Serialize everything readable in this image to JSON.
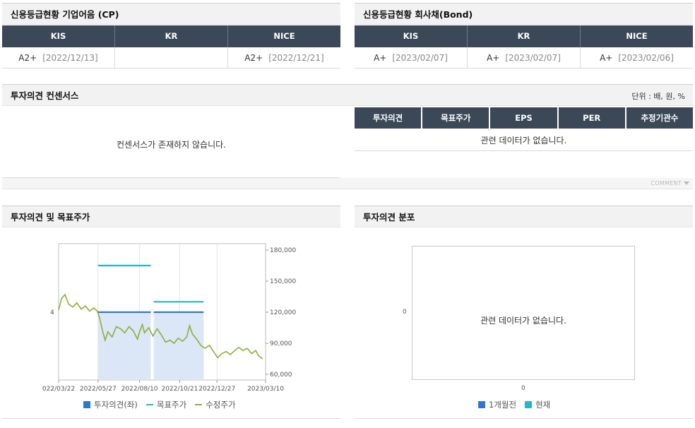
{
  "cp": {
    "title": "신용등급현황 기업어음 (CP)",
    "headers": [
      "KIS",
      "KR",
      "NICE"
    ],
    "values": [
      {
        "grade": "A2+",
        "date": "[2022/12/13]"
      },
      {
        "grade": "",
        "date": ""
      },
      {
        "grade": "A2+",
        "date": "[2022/12/21]"
      }
    ]
  },
  "bond": {
    "title": "신용등급현황 회사채(Bond)",
    "headers": [
      "KIS",
      "KR",
      "NICE"
    ],
    "values": [
      {
        "grade": "A+",
        "date": "[2023/02/07]"
      },
      {
        "grade": "A+",
        "date": "[2023/02/07]"
      },
      {
        "grade": "A+",
        "date": "[2023/02/06]"
      }
    ]
  },
  "consensus": {
    "title": "투자의견 컨센서스",
    "unit": "단위 : 배, 원, %",
    "empty_message": "컨센서스가 존재하지 않습니다.",
    "headers": [
      "투자의견",
      "목표주가",
      "EPS",
      "PER",
      "추정기관수"
    ],
    "table_empty": "관련 데이터가 없습니다.",
    "comment": "COMMENT"
  },
  "opinion_chart": {
    "title": "투자의견 및 목표주가",
    "legend": [
      "투자의견(좌)",
      "목표주가",
      "수정주가"
    ],
    "colors": {
      "opinion": "#2e75d4",
      "target": "#27b4c8",
      "price": "#8bb03a",
      "opinion_fill": "#dbe6f7"
    }
  },
  "dist_chart": {
    "title": "투자의견 분포",
    "empty": "관련 데이터가 없습니다.",
    "y_tick": "0",
    "x_tick": "0",
    "legend": [
      "1개월전",
      "현재"
    ],
    "colors": {
      "prev": "#2e75d4",
      "curr": "#27b4c8"
    }
  },
  "chart_data": [
    {
      "type": "line",
      "title": "",
      "x_ticks": [
        "022/03/22",
        "2022/05/27",
        "2022/08/10",
        "2022/10/21",
        "2022/12/27",
        "2023/03/10"
      ],
      "y_left_ticks": [
        "4"
      ],
      "y_right_ticks": [
        "180,000",
        "150,000",
        "120,000",
        "90,000",
        "60,000"
      ],
      "ylim_right": [
        60000,
        180000
      ],
      "series": [
        {
          "name": "투자의견(좌)",
          "segments": [
            {
              "x_start": "2022/05/27",
              "x_end": "2022/08/23",
              "value": 4
            },
            {
              "x_start": "2022/08/23",
              "x_end": "2022/12/14",
              "value": 4
            }
          ]
        },
        {
          "name": "목표주가",
          "segments": [
            {
              "x_start": "2022/05/27",
              "x_end": "2022/08/23",
              "value": 165000
            },
            {
              "x_start": "2022/08/23",
              "x_end": "2022/12/14",
              "value": 130000
            }
          ]
        },
        {
          "name": "수정주가",
          "points": [
            [
              0,
              122000
            ],
            [
              4,
              133000
            ],
            [
              9,
              137000
            ],
            [
              14,
              128000
            ],
            [
              20,
              125000
            ],
            [
              26,
              129000
            ],
            [
              32,
              123000
            ],
            [
              38,
              126000
            ],
            [
              44,
              121000
            ],
            [
              50,
              124000
            ],
            [
              55,
              121000
            ],
            [
              58,
              115000
            ],
            [
              62,
              103000
            ],
            [
              66,
              93000
            ],
            [
              70,
              101000
            ],
            [
              76,
              96000
            ],
            [
              82,
              106000
            ],
            [
              88,
              104000
            ],
            [
              94,
              100000
            ],
            [
              100,
              106000
            ],
            [
              106,
              102000
            ],
            [
              112,
              94000
            ],
            [
              116,
              103000
            ],
            [
              119,
              108000
            ],
            [
              122,
              100000
            ],
            [
              128,
              105000
            ],
            [
              134,
              97000
            ],
            [
              140,
              104000
            ],
            [
              146,
              98000
            ],
            [
              152,
              91000
            ],
            [
              158,
              93000
            ],
            [
              164,
              90000
            ],
            [
              170,
              95000
            ],
            [
              176,
              92000
            ],
            [
              182,
              96000
            ],
            [
              186,
              107000
            ],
            [
              190,
              99000
            ],
            [
              196,
              94000
            ],
            [
              202,
              88000
            ],
            [
              208,
              85000
            ],
            [
              214,
              88000
            ],
            [
              220,
              82000
            ],
            [
              226,
              76000
            ],
            [
              232,
              80000
            ],
            [
              238,
              82000
            ],
            [
              244,
              79000
            ],
            [
              250,
              83000
            ],
            [
              256,
              86000
            ],
            [
              262,
              83000
            ],
            [
              268,
              85000
            ],
            [
              274,
              80000
            ],
            [
              280,
              83000
            ],
            [
              284,
              78000
            ],
            [
              290,
              75000
            ]
          ]
        }
      ]
    },
    {
      "type": "bar",
      "title": "",
      "y_ticks": [
        "0"
      ],
      "x_ticks": [
        "0"
      ],
      "series": [
        {
          "name": "1개월전",
          "values": []
        },
        {
          "name": "현재",
          "values": []
        }
      ]
    }
  ]
}
